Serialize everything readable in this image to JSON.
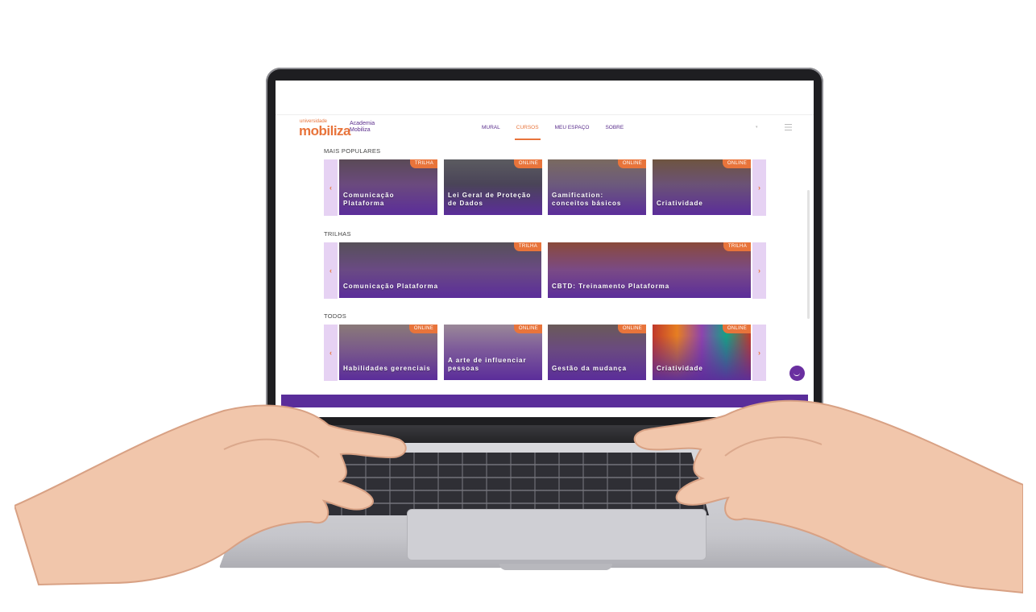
{
  "site": {
    "logo_small": "universidade",
    "logo_big": "mobiliza",
    "academy_line1": "Academia",
    "academy_line2": "Mobiliza",
    "nav": [
      "MURAL",
      "CURSOS",
      "MEU ESPAÇO",
      "SOBRE"
    ],
    "active_nav": "CURSOS"
  },
  "sections": [
    {
      "title": "MAIS POPULARES",
      "cards": [
        {
          "label": "Comunicação Plataforma",
          "badge": "TRILHA"
        },
        {
          "label": "Lei Geral de Proteção de Dados",
          "badge": "ONLINE"
        },
        {
          "label": "Gamification: conceitos básicos",
          "badge": "ONLINE"
        },
        {
          "label": "Criatividade",
          "badge": "ONLINE"
        }
      ]
    },
    {
      "title": "TRILHAS",
      "cards": [
        {
          "label": "Comunicação Plataforma",
          "badge": "TRILHA"
        },
        {
          "label": "CBTD: Treinamento Plataforma",
          "badge": "TRILHA"
        }
      ]
    },
    {
      "title": "TODOS",
      "cards": [
        {
          "label": "Habilidades gerenciais",
          "badge": "ONLINE"
        },
        {
          "label": "A arte de influenciar pessoas",
          "badge": "ONLINE"
        },
        {
          "label": "Gestão da mudança",
          "badge": "ONLINE"
        },
        {
          "label": "Criatividade",
          "badge": "ONLINE"
        }
      ]
    }
  ],
  "arrows": {
    "left": "‹",
    "right": "›"
  },
  "colors": {
    "brand_orange": "#e8743b",
    "brand_purple": "#5a2d9a",
    "arrow_bg": "#e6d2f3"
  }
}
